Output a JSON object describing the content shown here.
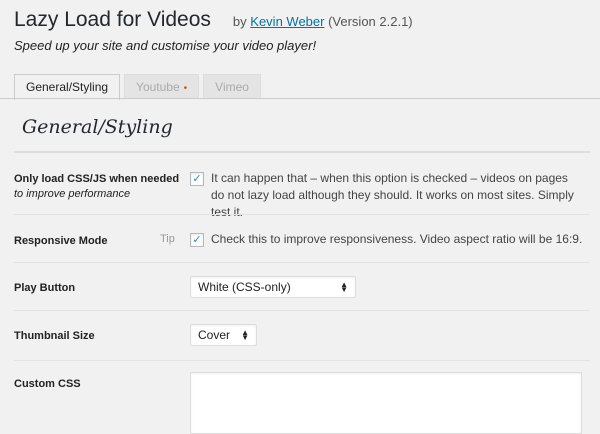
{
  "header": {
    "title": "Lazy Load for Videos",
    "by_prefix": "by",
    "author": "Kevin Weber",
    "version": "(Version 2.2.1)",
    "tagline": "Speed up your site and customise your video player!"
  },
  "tabs": [
    {
      "label": "General/Styling",
      "active": true
    },
    {
      "label": "Youtube",
      "active": false,
      "indicator": "•"
    },
    {
      "label": "Vimeo",
      "active": false
    }
  ],
  "section_title": "General/Styling",
  "settings": {
    "only_load": {
      "label": "Only load CSS/JS when needed",
      "sublabel": "to improve performance",
      "checked": true,
      "description": "It can happen that – when this option is checked – videos on pages do not lazy load although they should. It works on most sites. Simply test it."
    },
    "responsive": {
      "label": "Responsive Mode",
      "tip": "Tip",
      "checked": true,
      "description": "Check this to improve responsiveness. Video aspect ratio will be 16:9."
    },
    "play_button": {
      "label": "Play Button",
      "selected": "White (CSS-only)"
    },
    "thumbnail_size": {
      "label": "Thumbnail Size",
      "selected": "Cover"
    },
    "custom_css": {
      "label": "Custom CSS",
      "value": ""
    }
  },
  "icons": {
    "checkmark": "✓",
    "select_arrows": "▲▼"
  }
}
